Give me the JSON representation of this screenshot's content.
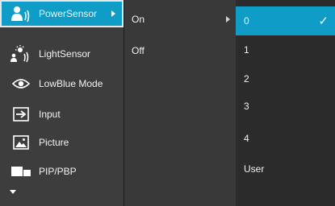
{
  "menu": {
    "items": [
      {
        "label": "PowerSensor",
        "icon": "power-sensor-icon"
      },
      {
        "label": "LightSensor",
        "icon": "light-sensor-icon"
      },
      {
        "label": "LowBlue Mode",
        "icon": "eye-icon"
      },
      {
        "label": "Input",
        "icon": "input-icon"
      },
      {
        "label": "Picture",
        "icon": "picture-icon"
      },
      {
        "label": "PIP/PBP",
        "icon": "pip-pbp-icon"
      }
    ],
    "more_icon": "chevron-down-icon"
  },
  "submenu": {
    "items": [
      {
        "label": "On"
      },
      {
        "label": "Off"
      }
    ]
  },
  "options": {
    "items": [
      {
        "label": "0"
      },
      {
        "label": "1"
      },
      {
        "label": "2"
      },
      {
        "label": "3"
      },
      {
        "label": "4"
      },
      {
        "label": "User"
      }
    ],
    "selected_check": "✓"
  },
  "colors": {
    "accent": "#0f9cc6",
    "panel": "#3d3d3d",
    "panel_dark": "#2b2b2b",
    "text": "#f2f2f2"
  }
}
